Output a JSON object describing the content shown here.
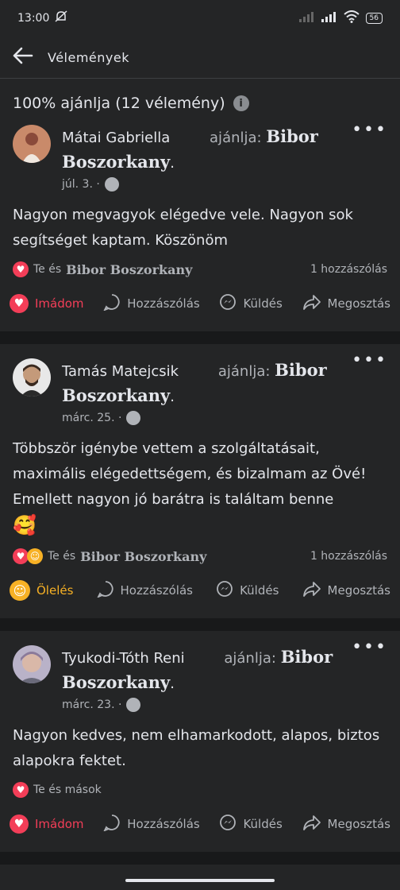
{
  "status": {
    "time": "13:00",
    "battery": "56"
  },
  "header": {
    "title": "Vélemények"
  },
  "summary": {
    "text": "100% ajánlja (12 vélemény)"
  },
  "posts": [
    {
      "name": "Mátai Gabriella",
      "recommends": "ajánlja:",
      "page": "Bibor Boszorkany",
      "date": "júl. 3. ·",
      "text": "Nagyon megvagyok elégedve vele.  Nagyon sok segítséget kaptam. Köszönöm",
      "reactions_prefix": "Te és",
      "reactions_page": "Bibor Boszorkany",
      "comments": "1 hozzászólás",
      "reaction_label": "Imádom",
      "comment_label": "Hozzászólás",
      "send_label": "Küldés",
      "share_label": "Megosztás"
    },
    {
      "name": "Tamás Matejcsik",
      "recommends": "ajánlja:",
      "page": "Bibor Boszorkany",
      "date": "márc. 25. ·",
      "text": "Többször igénybe vettem a szolgáltatásait, maximális elégedettségem, és bizalmam az Övé! Emellett nagyon jó barátra is találtam benne",
      "emoji": "🥰",
      "reactions_prefix": "Te és",
      "reactions_page": "Bibor Boszorkany",
      "comments": "1 hozzászólás",
      "reaction_label": "Ölelés",
      "comment_label": "Hozzászólás",
      "send_label": "Küldés",
      "share_label": "Megosztás"
    },
    {
      "name": "Tyukodi-Tóth Reni",
      "recommends": "ajánlja:",
      "page": "Bibor Boszorkany",
      "date": "márc. 23. ·",
      "text": "Nagyon kedves, nem elhamarkodott, alapos, biztos alapokra fektet.",
      "reactions_text": "Te és mások",
      "reaction_label": "Imádom",
      "comment_label": "Hozzászólás",
      "send_label": "Küldés",
      "share_label": "Megosztás"
    }
  ],
  "colors": {
    "background": "#242526",
    "separator": "#18191a",
    "love": "#f33e58",
    "care": "#f7b125"
  }
}
